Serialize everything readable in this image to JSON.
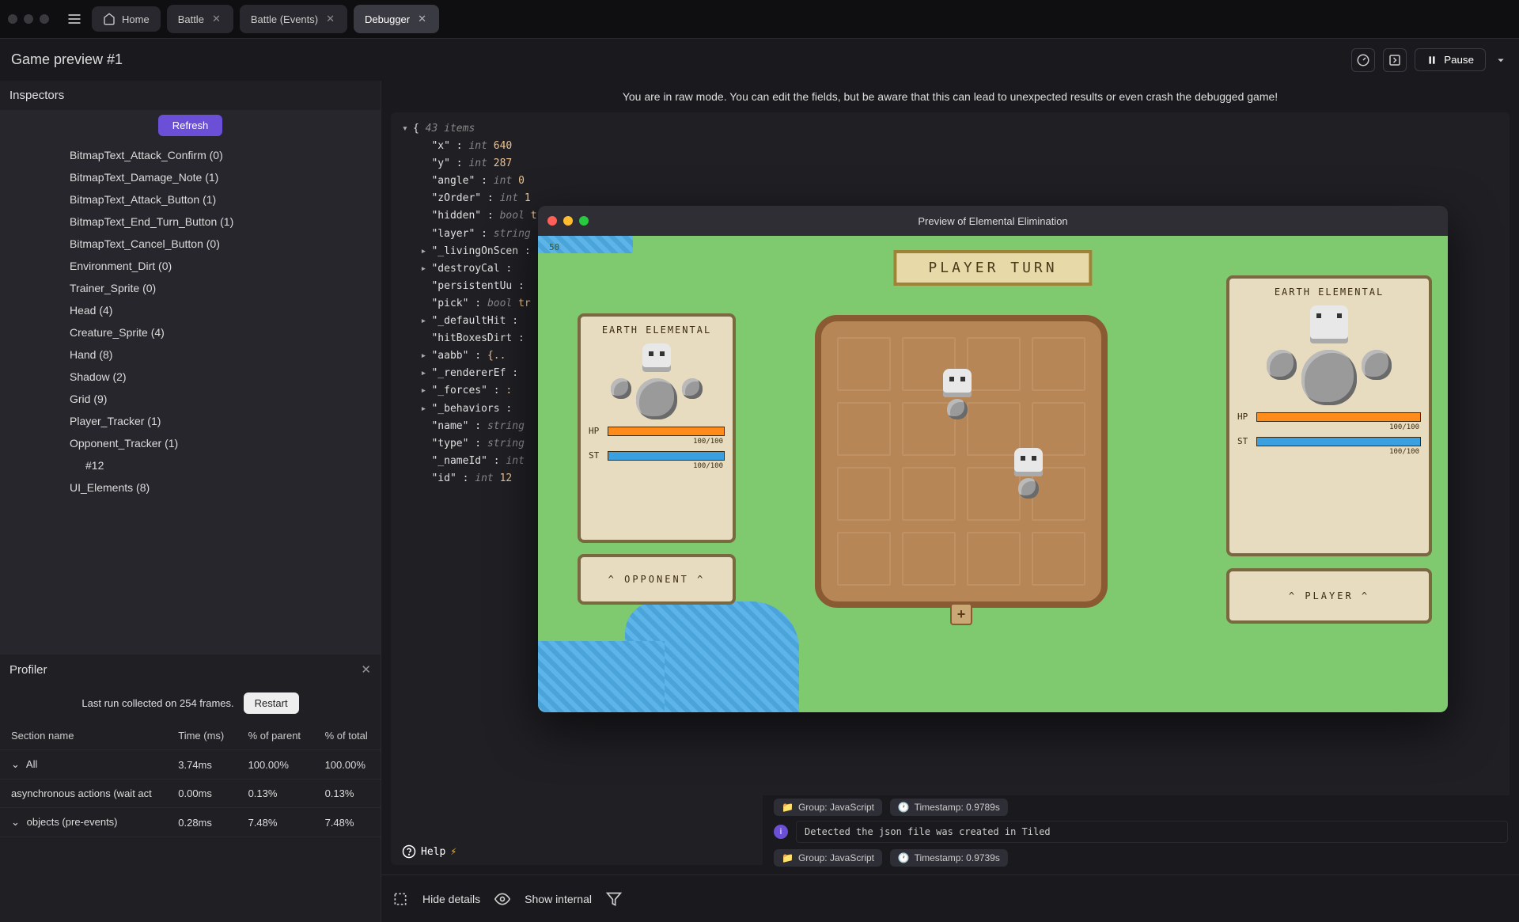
{
  "titlebar": {
    "tabs": [
      {
        "label": "Home",
        "icon": "home"
      },
      {
        "label": "Battle",
        "closable": true
      },
      {
        "label": "Battle (Events)",
        "closable": true
      },
      {
        "label": "Debugger",
        "closable": true,
        "active": true
      }
    ]
  },
  "subheader": {
    "title": "Game preview #1",
    "pause": "Pause"
  },
  "inspectors": {
    "title": "Inspectors",
    "refresh": "Refresh",
    "items": [
      "BitmapText_Attack_Confirm (0)",
      "BitmapText_Damage_Note (1)",
      "BitmapText_Attack_Button (1)",
      "BitmapText_End_Turn_Button (1)",
      "BitmapText_Cancel_Button (0)",
      "Environment_Dirt (0)",
      "Trainer_Sprite (0)",
      "Head (4)",
      "Creature_Sprite (4)",
      "Hand (8)",
      "Shadow (2)",
      "Grid (9)",
      "Player_Tracker (1)",
      "Opponent_Tracker (1)"
    ],
    "sub_items": [
      "#12"
    ],
    "tail_item": "UI_Elements (8)"
  },
  "profiler": {
    "title": "Profiler",
    "info": "Last run collected on 254 frames.",
    "restart": "Restart",
    "columns": [
      "Section name",
      "Time (ms)",
      "% of parent",
      "% of total"
    ],
    "rows": [
      {
        "name": "All",
        "time": "3.74ms",
        "parent": "100.00%",
        "total": "100.00%",
        "expand": true
      },
      {
        "name": "asynchronous actions (wait act",
        "time": "0.00ms",
        "parent": "0.13%",
        "total": "0.13%"
      },
      {
        "name": "objects (pre-events)",
        "time": "0.28ms",
        "parent": "7.48%",
        "total": "7.48%",
        "expand": true
      }
    ]
  },
  "warning": "You are in raw mode. You can edit the fields, but be aware that this can lead to unexpected results or even crash the debugged game!",
  "json": {
    "root": "43 items",
    "lines": [
      {
        "k": "\"x\"",
        "t": "int",
        "v": "640"
      },
      {
        "k": "\"y\"",
        "t": "int",
        "v": "287"
      },
      {
        "k": "\"angle\"",
        "t": "int",
        "v": "0"
      },
      {
        "k": "\"zOrder\"",
        "t": "int",
        "v": "1"
      },
      {
        "k": "\"hidden\"",
        "t": "bool",
        "v": "true"
      },
      {
        "k": "\"layer\"",
        "t": "string",
        "v": "\"\""
      },
      {
        "k": "\"_livingOnScen",
        "t": "",
        "v": "",
        "tri": true
      },
      {
        "k": "\"destroyCal",
        "t": "",
        "v": "",
        "tri": true
      },
      {
        "k": "\"persistentUu",
        "t": "",
        "v": ""
      },
      {
        "k": "\"pick\"",
        "t": "bool",
        "v": "tr"
      },
      {
        "k": "\"_defaultHit",
        "t": "",
        "v": "",
        "tri": true
      },
      {
        "k": "\"hitBoxesDirt",
        "t": "",
        "v": ""
      },
      {
        "k": "\"aabb\"",
        "t": "",
        "v": "{..",
        "tri": true
      },
      {
        "k": "\"_rendererEf",
        "t": "",
        "v": "",
        "tri": true
      },
      {
        "k": "\"_forces\"",
        "t": "",
        "v": ":",
        "tri": true
      },
      {
        "k": "\"_behaviors",
        "t": "",
        "v": "",
        "tri": true
      },
      {
        "k": "\"name\"",
        "t": "string",
        "v": ""
      },
      {
        "k": "\"type\"",
        "t": "string",
        "v": ""
      },
      {
        "k": "\"_nameId\"",
        "t": "int",
        "v": ""
      },
      {
        "k": "\"id\"",
        "t": "int",
        "v": "12"
      }
    ],
    "help": "Help"
  },
  "console": {
    "group1": "Group: JavaScript",
    "ts1": "Timestamp: 0.9789s",
    "group2": "Group: JavaScript",
    "ts2": "Timestamp: 0.9739s",
    "msg": "Detected the json file was created in Tiled"
  },
  "bottombar": {
    "hide": "Hide details",
    "show": "Show internal"
  },
  "game": {
    "window_title": "Preview of Elemental Elimination",
    "turn": "PLAYER TURN",
    "left_card_title": "EARTH ELEMENTAL",
    "right_card_title": "EARTH ELEMENTAL",
    "opp_label": "^ OPPONENT ^",
    "ply_label": "^ PLAYER ^",
    "hp": "HP",
    "st": "ST",
    "hp_val": "100/100",
    "st_val": "100/100"
  }
}
